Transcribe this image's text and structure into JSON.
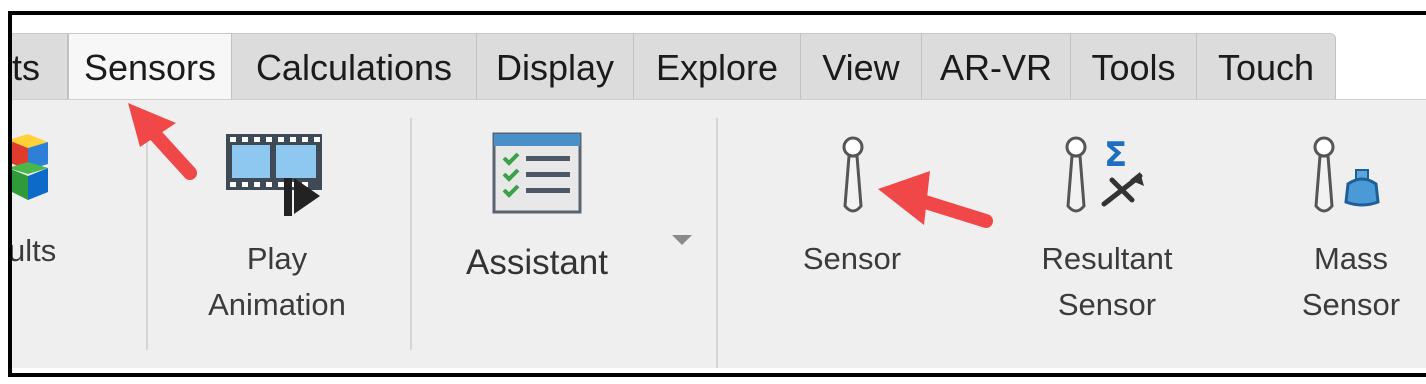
{
  "tabs": [
    {
      "label": "ts",
      "active": false
    },
    {
      "label": "Sensors",
      "active": true
    },
    {
      "label": "Calculations",
      "active": false
    },
    {
      "label": "Display",
      "active": false
    },
    {
      "label": "Explore",
      "active": false
    },
    {
      "label": "View",
      "active": false
    },
    {
      "label": "AR-VR",
      "active": false
    },
    {
      "label": "Tools",
      "active": false
    },
    {
      "label": "Touch",
      "active": false
    }
  ],
  "ribbon": {
    "results_label": "ults",
    "play_animation": {
      "line1": "Play",
      "line2": "Animation"
    },
    "assistant_label": "Assistant",
    "sensor_label": "Sensor",
    "resultant_sensor": {
      "line1": "Resultant",
      "line2": "Sensor"
    },
    "mass_sensor": {
      "line1": "Mass",
      "line2": "Sensor"
    }
  },
  "icons": {
    "results": "stacked-color-blocks-icon",
    "play_animation": "film-strip-play-icon",
    "assistant": "checklist-window-icon",
    "assistant_dropdown": "triangle-down-icon",
    "sensor": "probe-icon",
    "resultant_sensor": "probe-sigma-icon",
    "mass_sensor": "probe-weight-icon"
  },
  "colors": {
    "annotation_arrow": "#f04848",
    "active_tab": "#f7f7f7",
    "inactive_tab": "#dcdcdc",
    "ribbon": "#efefef"
  }
}
